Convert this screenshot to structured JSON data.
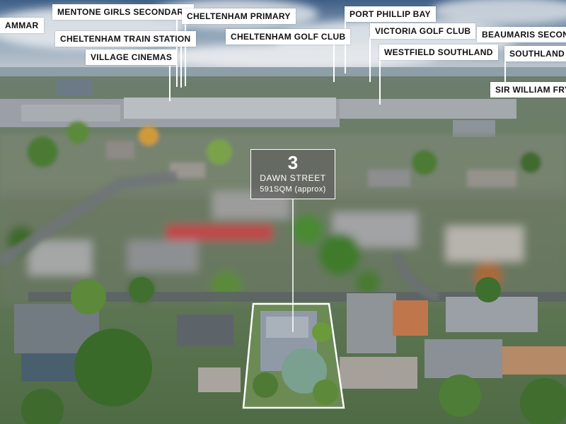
{
  "landmarks": [
    {
      "id": "grammar",
      "label": "AMMAR"
    },
    {
      "id": "mentone-girls",
      "label": "MENTONE GIRLS SECONDARY"
    },
    {
      "id": "cheltenham-primary",
      "label": "CHELTENHAM PRIMARY"
    },
    {
      "id": "port-phillip",
      "label": "PORT PHILLIP BAY"
    },
    {
      "id": "cheltenham-station",
      "label": "CHELTENHAM TRAIN STATION"
    },
    {
      "id": "victoria-golf",
      "label": "VICTORIA GOLF CLUB"
    },
    {
      "id": "beaumaris",
      "label": "BEAUMARIS SECONDA"
    },
    {
      "id": "cheltenham-golf",
      "label": "CHELTENHAM GOLF CLUB"
    },
    {
      "id": "village-cinemas",
      "label": "VILLAGE CINEMAS"
    },
    {
      "id": "westfield",
      "label": "WESTFIELD SOUTHLAND"
    },
    {
      "id": "southland-station",
      "label": "SOUTHLAND T"
    },
    {
      "id": "sir-william-fry",
      "label": "SIR WILLIAM FRY R"
    }
  ],
  "property": {
    "number": "3",
    "street": "DAWN STREET",
    "area": "591SQM (approx)"
  },
  "colors": {
    "label_bg": "#ffffff",
    "label_text": "#111111",
    "overlay": "#5a5a5a",
    "outline": "#ffffff"
  }
}
